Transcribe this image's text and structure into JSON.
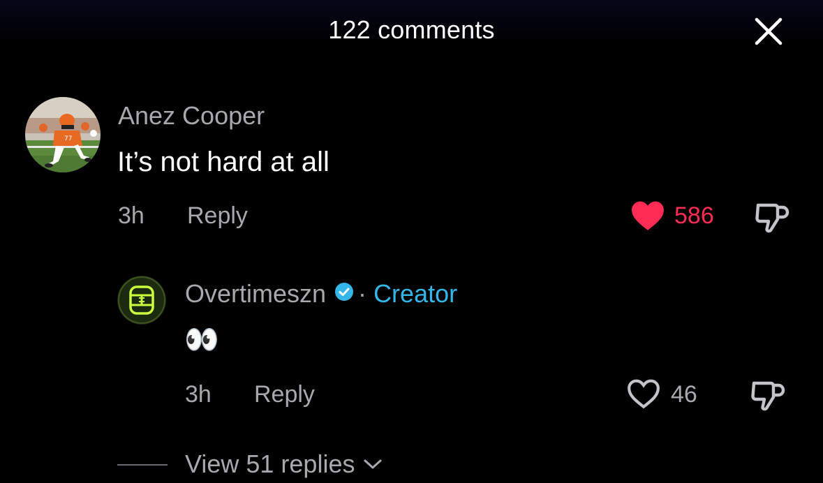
{
  "header": {
    "title": "122 comments",
    "close_icon": "close-icon"
  },
  "comment": {
    "username": "Anez Cooper",
    "text": "It’s not hard at all",
    "time": "3h",
    "reply_label": "Reply",
    "like_count": "586",
    "liked": true,
    "like_color": "#fe2c55",
    "avatar_icon": "avatar-football-player"
  },
  "reply": {
    "username": "Overtimeszn",
    "verified": true,
    "separator": "·",
    "creator_label": "Creator",
    "creator_color": "#35b6e8",
    "text": "👀",
    "time": "3h",
    "reply_label": "Reply",
    "like_count": "46",
    "liked": false,
    "avatar_icon": "overtime-logo-avatar"
  },
  "view_replies": {
    "label": "View 51 replies"
  }
}
